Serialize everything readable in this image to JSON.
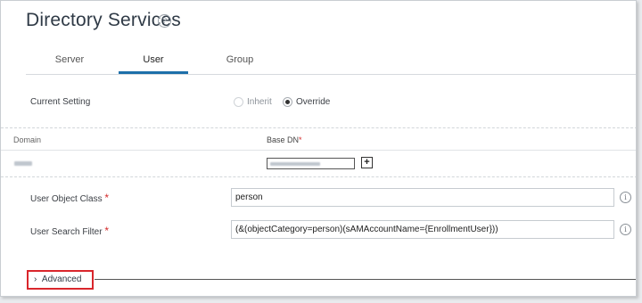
{
  "page": {
    "title": "Directory Services",
    "help_glyph": "?"
  },
  "tabs": [
    {
      "label": "Server",
      "active": false
    },
    {
      "label": "User",
      "active": true
    },
    {
      "label": "Group",
      "active": false
    }
  ],
  "current_setting": {
    "label": "Current Setting",
    "options": [
      {
        "label": "Inherit",
        "selected": false,
        "disabled": true
      },
      {
        "label": "Override",
        "selected": true,
        "disabled": false
      }
    ]
  },
  "domain_table": {
    "col_domain": "Domain",
    "col_base_dn": "Base DN",
    "required_mark": "*",
    "add_glyph": "+"
  },
  "fields": {
    "user_object_class": {
      "label": "User Object Class",
      "value": "person"
    },
    "user_search_filter": {
      "label": "User Search Filter",
      "value": "(&(objectCategory=person)(sAMAccountName={EnrollmentUser}))"
    },
    "info_glyph": "i"
  },
  "advanced": {
    "chevron": "›",
    "label": "Advanced"
  },
  "colors": {
    "accent": "#1e6fa9",
    "required": "#d32a2a",
    "highlight": "#d9262c"
  }
}
